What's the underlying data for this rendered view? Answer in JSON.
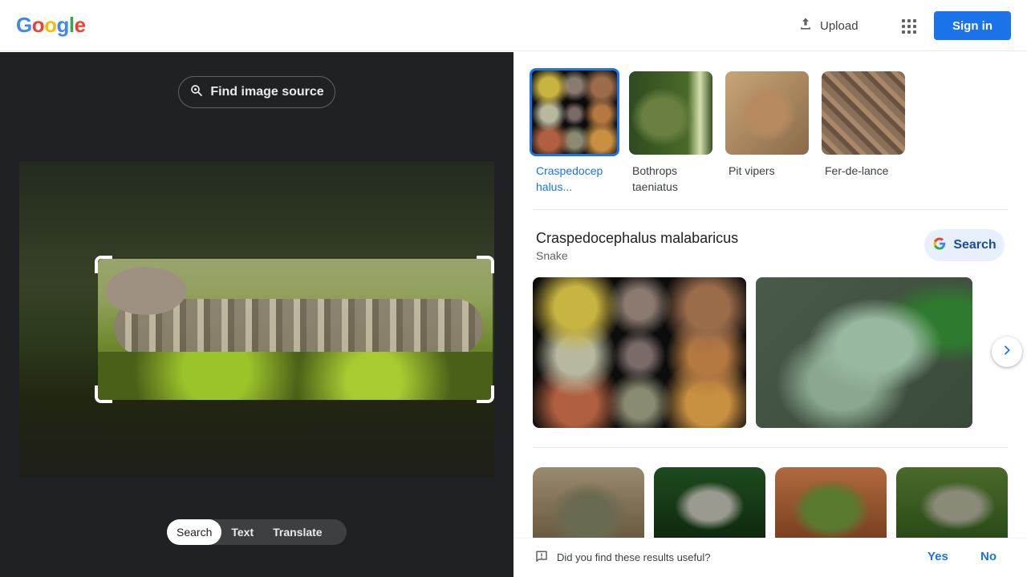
{
  "header": {
    "logo_letters": [
      {
        "ch": "G",
        "color": "#4285F4"
      },
      {
        "ch": "o",
        "color": "#EA4335"
      },
      {
        "ch": "o",
        "color": "#FBBC05"
      },
      {
        "ch": "g",
        "color": "#4285F4"
      },
      {
        "ch": "l",
        "color": "#34A853"
      },
      {
        "ch": "e",
        "color": "#EA4335"
      }
    ],
    "upload_label": "Upload",
    "apps_icon": "apps-grid-icon",
    "signin_label": "Sign in"
  },
  "left": {
    "find_source_label": "Find image source",
    "modes": [
      "Search",
      "Text",
      "Translate"
    ],
    "active_mode": "Search"
  },
  "right": {
    "chips": [
      {
        "label": "Craspedocep halus...",
        "selected": true
      },
      {
        "label": "Bothrops taeniatus",
        "selected": false
      },
      {
        "label": "Pit vipers",
        "selected": false
      },
      {
        "label": "Fer-de-lance",
        "selected": false
      }
    ],
    "kg": {
      "title": "Craspedocephalus malabaricus",
      "subtitle": "Snake",
      "search_label": "Search"
    },
    "feedback": {
      "question": "Did you find these results useful?",
      "yes": "Yes",
      "no": "No"
    }
  },
  "colors": {
    "accent": "#1a73e8",
    "left_bg": "#202124"
  }
}
